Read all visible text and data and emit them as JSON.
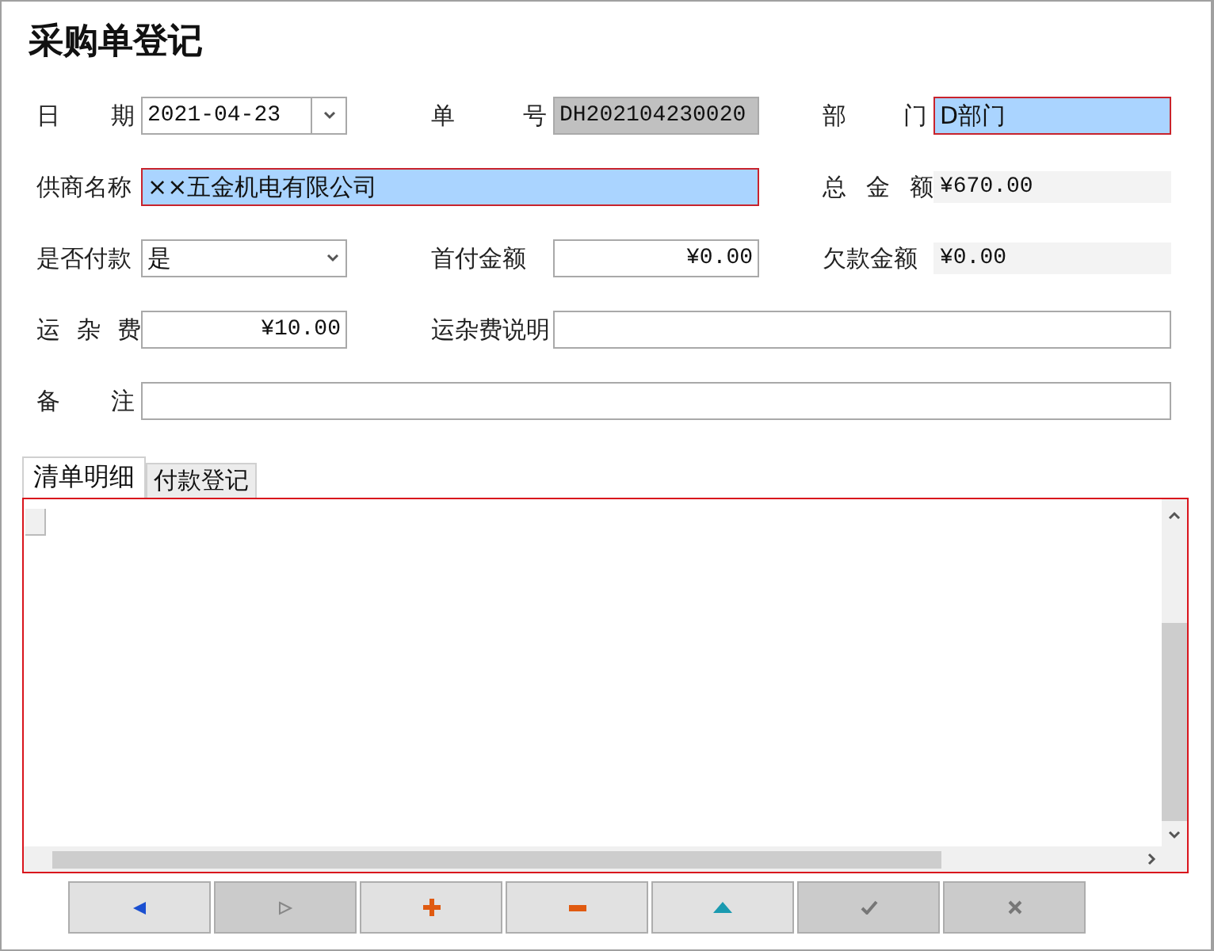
{
  "window": {
    "title": "采购单登记"
  },
  "form": {
    "rows": [
      {
        "fields": [
          {
            "label": "日 期",
            "value": "2021-04-23",
            "kind": "date",
            "highlighted": false,
            "wide": false
          },
          {
            "label": "单 号",
            "value": "DH202104230020",
            "kind": "readonly",
            "highlighted": false,
            "wide": false
          },
          {
            "label": "部 门",
            "value": "D部门",
            "kind": "text",
            "highlighted": true,
            "wide": false
          }
        ]
      },
      {
        "fields": [
          {
            "label": "供商名称",
            "value": "××五金机电有限公司",
            "kind": "text",
            "highlighted": true,
            "wide": true
          },
          {
            "label": "总 金 额",
            "value": "¥670.00",
            "kind": "display",
            "highlighted": false,
            "wide": false
          }
        ]
      },
      {
        "fields": [
          {
            "label": "是否付款",
            "value": "是",
            "kind": "select",
            "highlighted": false,
            "wide": false
          },
          {
            "label": "首付金额",
            "value": "¥0.00",
            "kind": "money",
            "highlighted": false,
            "wide": false
          },
          {
            "label": "欠款金额",
            "value": "¥0.00",
            "kind": "display",
            "highlighted": false,
            "wide": false
          }
        ]
      },
      {
        "fields": [
          {
            "label": "运 杂 费",
            "value": "¥10.00",
            "kind": "money",
            "highlighted": false,
            "wide": false
          },
          {
            "label": "运杂费说明",
            "kind": "text",
            "highlighted": false,
            "wide": true
          }
        ]
      },
      {
        "fields": [
          {
            "label": "备 注",
            "kind": "text",
            "highlighted": false,
            "wide": true
          }
        ]
      }
    ]
  },
  "tabs": [
    {
      "label": "清单明细",
      "selected": true
    },
    {
      "label": "付款登记",
      "selected": false
    }
  ],
  "buttons": [
    {
      "kind": "prev",
      "disabled": false
    },
    {
      "kind": "next",
      "disabled": true
    },
    {
      "kind": "add",
      "disabled": false
    },
    {
      "kind": "remove",
      "disabled": false
    },
    {
      "kind": "up",
      "disabled": false
    },
    {
      "kind": "confirm",
      "disabled": true
    },
    {
      "kind": "cancel",
      "disabled": true
    }
  ]
}
